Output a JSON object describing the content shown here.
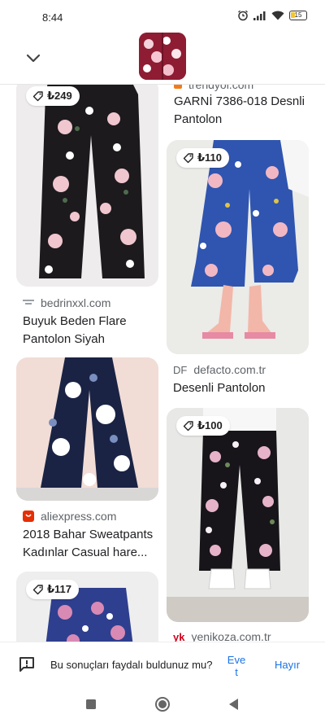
{
  "status_bar": {
    "time": "8:44",
    "battery": "15"
  },
  "header": {
    "collapse_icon": "chevron-down-icon",
    "thumbnail_icon": "query-image-thumbnail"
  },
  "results": [
    {
      "price": "₺249",
      "source": "bedrinxxl.com",
      "title_line1": "Buyuk Beden Flare",
      "title_line2": "Pantolon Siyah"
    },
    {
      "source": "trendyol.com",
      "title_line1": "GARNİ 7386-018 Desnli",
      "title_line2": "Pantolon"
    },
    {
      "price": "₺110",
      "source_logo": "DF",
      "source": "defacto.com.tr",
      "title_line1": "Desenli Pantolon"
    },
    {
      "source": "aliexpress.com",
      "title_line1": "2018 Bahar Sweatpants",
      "title_line2": "Kadınlar Casual hare..."
    },
    {
      "price": "₺100",
      "source_logo": "yk",
      "source": "yenikoza.com.tr"
    },
    {
      "price": "₺117"
    }
  ],
  "feedback": {
    "question": "Bu sonuçları faydalı buldunuz mu?",
    "yes_line1": "Eve",
    "yes_line2": "t",
    "no": "Hayır"
  },
  "colors": {
    "link_blue": "#1a73e8",
    "text_dark": "#202124",
    "text_gray": "#5f6368",
    "aliexpress_red": "#e62e04",
    "yenikoza_red": "#d0021b"
  }
}
